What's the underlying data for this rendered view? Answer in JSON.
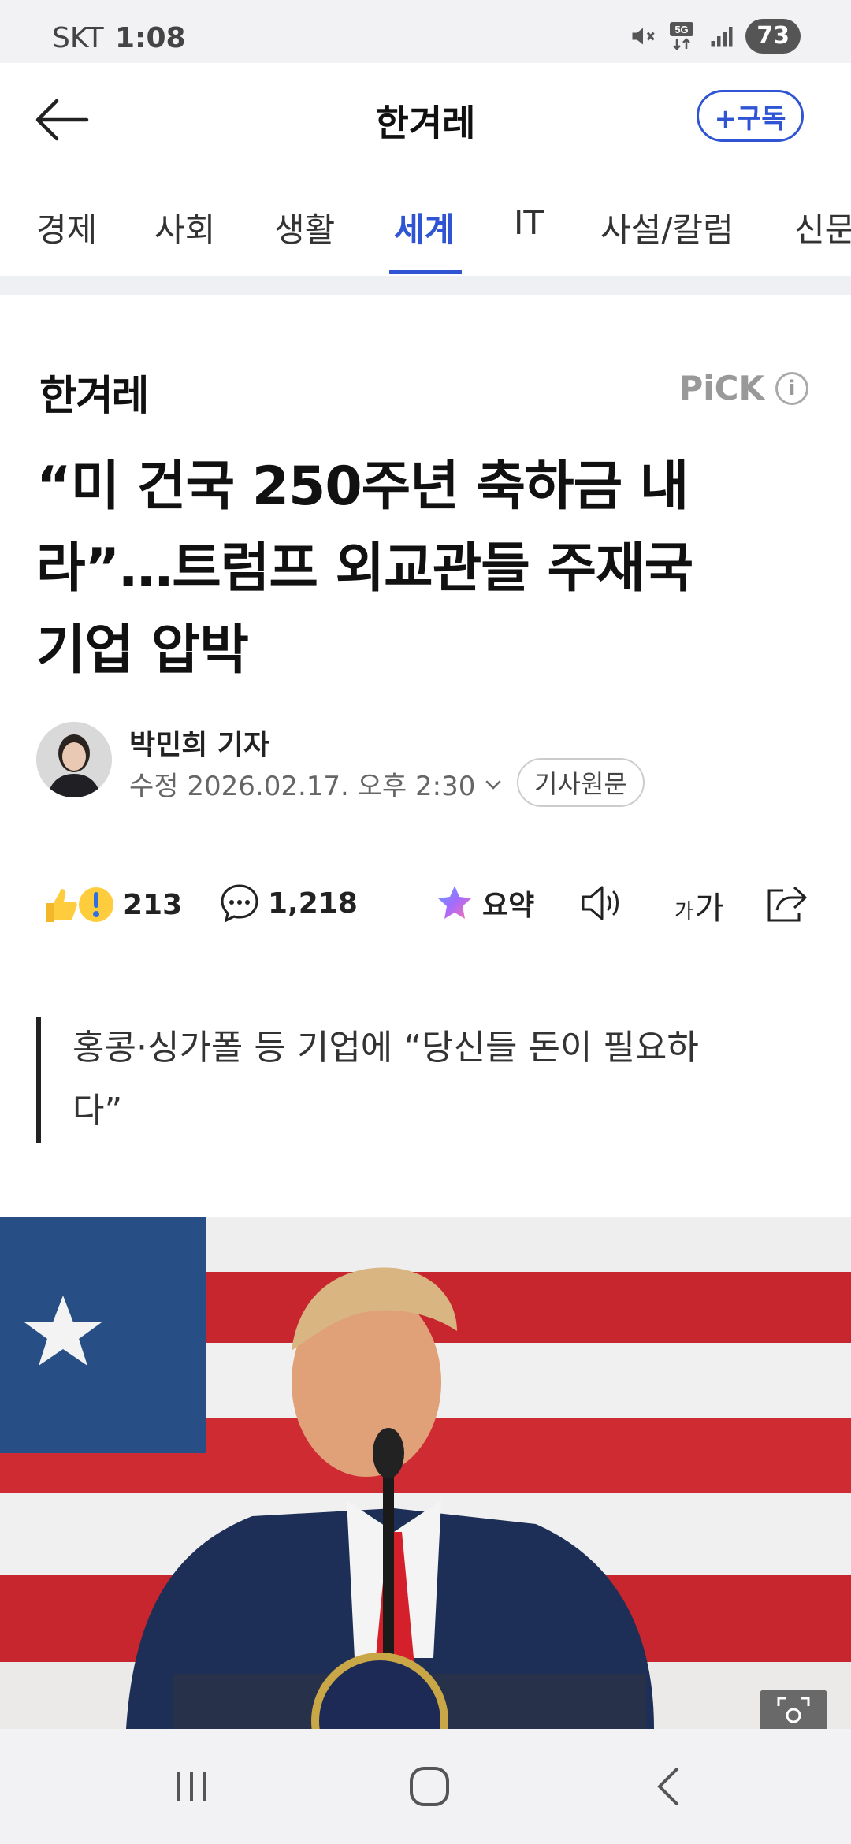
{
  "status_bar": {
    "carrier": "SKT",
    "time": "1:08",
    "network": "5G",
    "battery": "73",
    "icons": [
      "mute-icon",
      "5g-data-icon",
      "signal-icon",
      "battery-icon"
    ]
  },
  "header": {
    "back_icon": "arrow-left-icon",
    "title": "한겨레",
    "subscribe_label": "+구독",
    "accent_color": "#2f55d4"
  },
  "tabs": [
    {
      "label": "경제",
      "active": false
    },
    {
      "label": "사회",
      "active": false
    },
    {
      "label": "생활",
      "active": false
    },
    {
      "label": "세계",
      "active": true
    },
    {
      "label": "IT",
      "active": false
    },
    {
      "label": "사설/칼럼",
      "active": false
    },
    {
      "label": "신문",
      "active": false
    }
  ],
  "article": {
    "source_logo": "한겨레",
    "pick_label": "PiCK",
    "headline_lines": [
      "“미 건국 250주년 축하금 내",
      "라”…트럼프 외교관들 주재국",
      "기업 압박"
    ],
    "author": "박민희 기자",
    "date": "수정 2026.02.17. 오후 2:30",
    "original_label": "기사원문",
    "reactions_count": "213",
    "comments_count": "1,218",
    "summary_label": "요약",
    "font_size_label_small": "가",
    "font_size_label_large": "가",
    "quote_lines": [
      "홍콩·싱가폴 등 기업에 “당신들 돈이 필요하",
      "다”"
    ]
  },
  "nav_bar": {
    "icons": [
      "recent-apps-icon",
      "home-icon",
      "back-icon"
    ]
  }
}
